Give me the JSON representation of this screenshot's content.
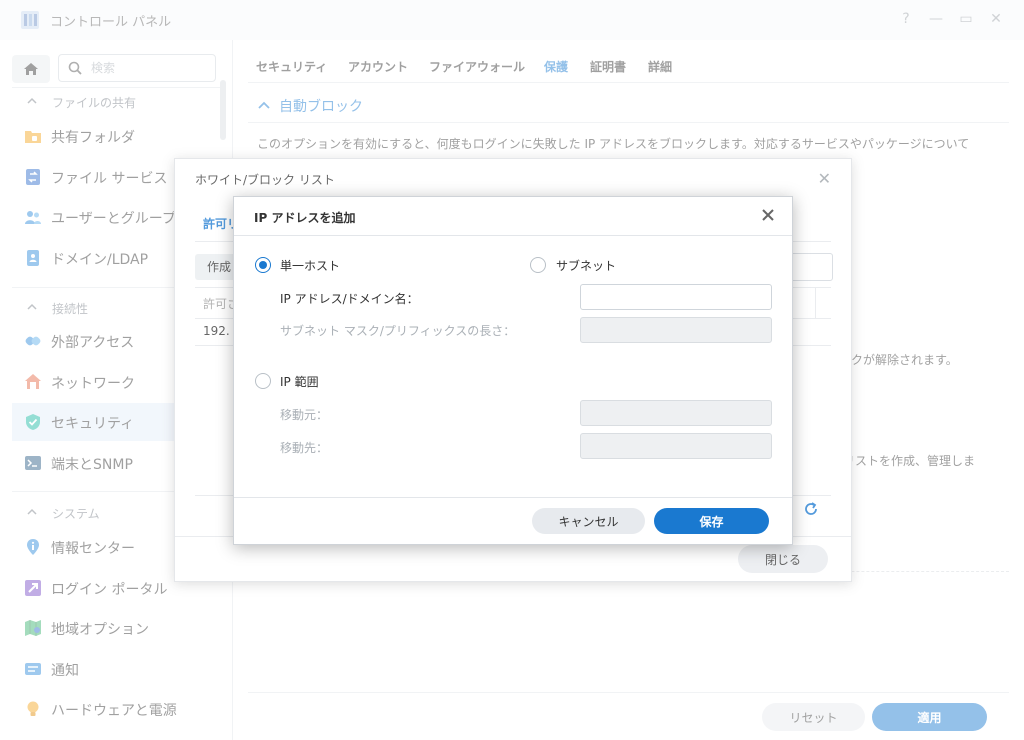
{
  "window": {
    "title": "コントロール パネル",
    "controls": [
      "?",
      "—",
      "▭",
      "✕"
    ]
  },
  "sidebar": {
    "search_placeholder": "検索",
    "sections": [
      {
        "label": "ファイルの共有",
        "items": [
          {
            "label": "共有フォルダ",
            "icon": "folder-icon"
          },
          {
            "label": "ファイル サービス",
            "icon": "file-services-icon"
          },
          {
            "label": "ユーザーとグループ",
            "icon": "users-icon"
          },
          {
            "label": "ドメイン/LDAP",
            "icon": "domain-icon"
          }
        ]
      },
      {
        "label": "接続性",
        "items": [
          {
            "label": "外部アクセス",
            "icon": "external-access-icon"
          },
          {
            "label": "ネットワーク",
            "icon": "network-icon"
          },
          {
            "label": "セキュリティ",
            "icon": "security-shield-icon",
            "active": true
          },
          {
            "label": "端末とSNMP",
            "icon": "terminal-icon"
          }
        ]
      },
      {
        "label": "システム",
        "items": [
          {
            "label": "情報センター",
            "icon": "info-icon"
          },
          {
            "label": "ログイン ポータル",
            "icon": "login-portal-icon"
          },
          {
            "label": "地域オプション",
            "icon": "region-icon"
          },
          {
            "label": "通知",
            "icon": "notification-icon"
          },
          {
            "label": "ハードウェアと電源",
            "icon": "hardware-power-icon"
          }
        ]
      }
    ]
  },
  "main": {
    "tabs": [
      "セキュリティ",
      "アカウント",
      "ファイアウォール",
      "保護",
      "証明書",
      "詳細"
    ],
    "active_tab": "保護",
    "section_title": "自動ブロック",
    "description": "このオプションを有効にすると、何度もログインに失敗した IP アドレスをブロックします。対応するサービスやパッケージについて",
    "partial_text_1": "クが解除されます。",
    "partial_text_2": "リストを作成、管理しま",
    "reset_button": "リセット",
    "apply_button": "適用"
  },
  "wb_dialog": {
    "title": "ホワイト/ブロック リスト",
    "tab_partial": "許可リ",
    "create_partial": "作成",
    "column_partial": "許可さ",
    "row_partial": "192.",
    "close_button": "閉じる"
  },
  "ip_dialog": {
    "title": "IP アドレスを追加",
    "single_host": "単一ホスト",
    "subnet": "サブネット",
    "ip_domain_label": "IP アドレス/ドメイン名：",
    "subnet_mask_label": "サブネット マスク/プリフィックスの長さ：",
    "ip_range": "IP 範囲",
    "from_label": "移動元：",
    "to_label": "移動先：",
    "ip_domain_value": "",
    "cancel_button": "キャンセル",
    "save_button": "保存",
    "selected_mode": "単一ホスト"
  }
}
